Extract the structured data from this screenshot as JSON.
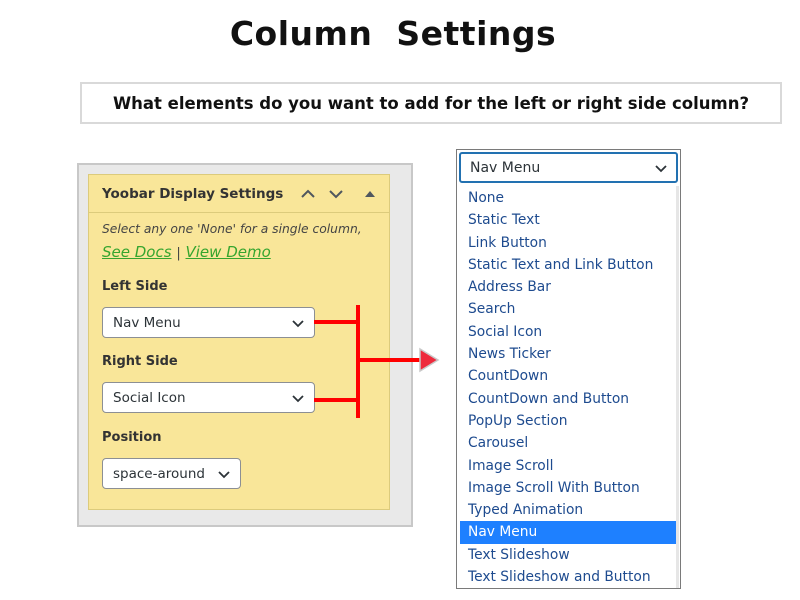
{
  "page_title": "Column  Settings",
  "question": "What elements do you want to add for the left or right side column?",
  "panel": {
    "title": "Yoobar Display Settings",
    "note": "Select any one 'None' for a single column,",
    "links": {
      "docs": "See Docs",
      "separator": "|",
      "demo": "View Demo"
    },
    "left_side": {
      "label": "Left Side",
      "value": "Nav Menu"
    },
    "right_side": {
      "label": "Right Side",
      "value": "Social Icon"
    },
    "position": {
      "label": "Position",
      "value": "space-around"
    }
  },
  "dropdown": {
    "selected": "Nav Menu",
    "options": [
      "None",
      "Static Text",
      "Link Button",
      "Static Text and Link Button",
      "Address Bar",
      "Search",
      "Social Icon",
      "News Ticker",
      "CountDown",
      "CountDown and Button",
      "PopUp Section",
      "Carousel",
      "Image Scroll",
      "Image Scroll With Button",
      "Typed Animation",
      "Nav Menu",
      "Text Slideshow",
      "Text Slideshow and Button"
    ]
  },
  "colors": {
    "panel_bg": "#f9e699",
    "connector": "#ff0000",
    "link": "#35a52e",
    "option_text": "#1e4b8f",
    "option_selected_bg": "#1e80ff",
    "focus_border": "#2271b1"
  },
  "icons": [
    "chevron-up-icon",
    "chevron-down-icon",
    "triangle-up-icon",
    "chevron-down-icon",
    "arrow-right-icon"
  ]
}
